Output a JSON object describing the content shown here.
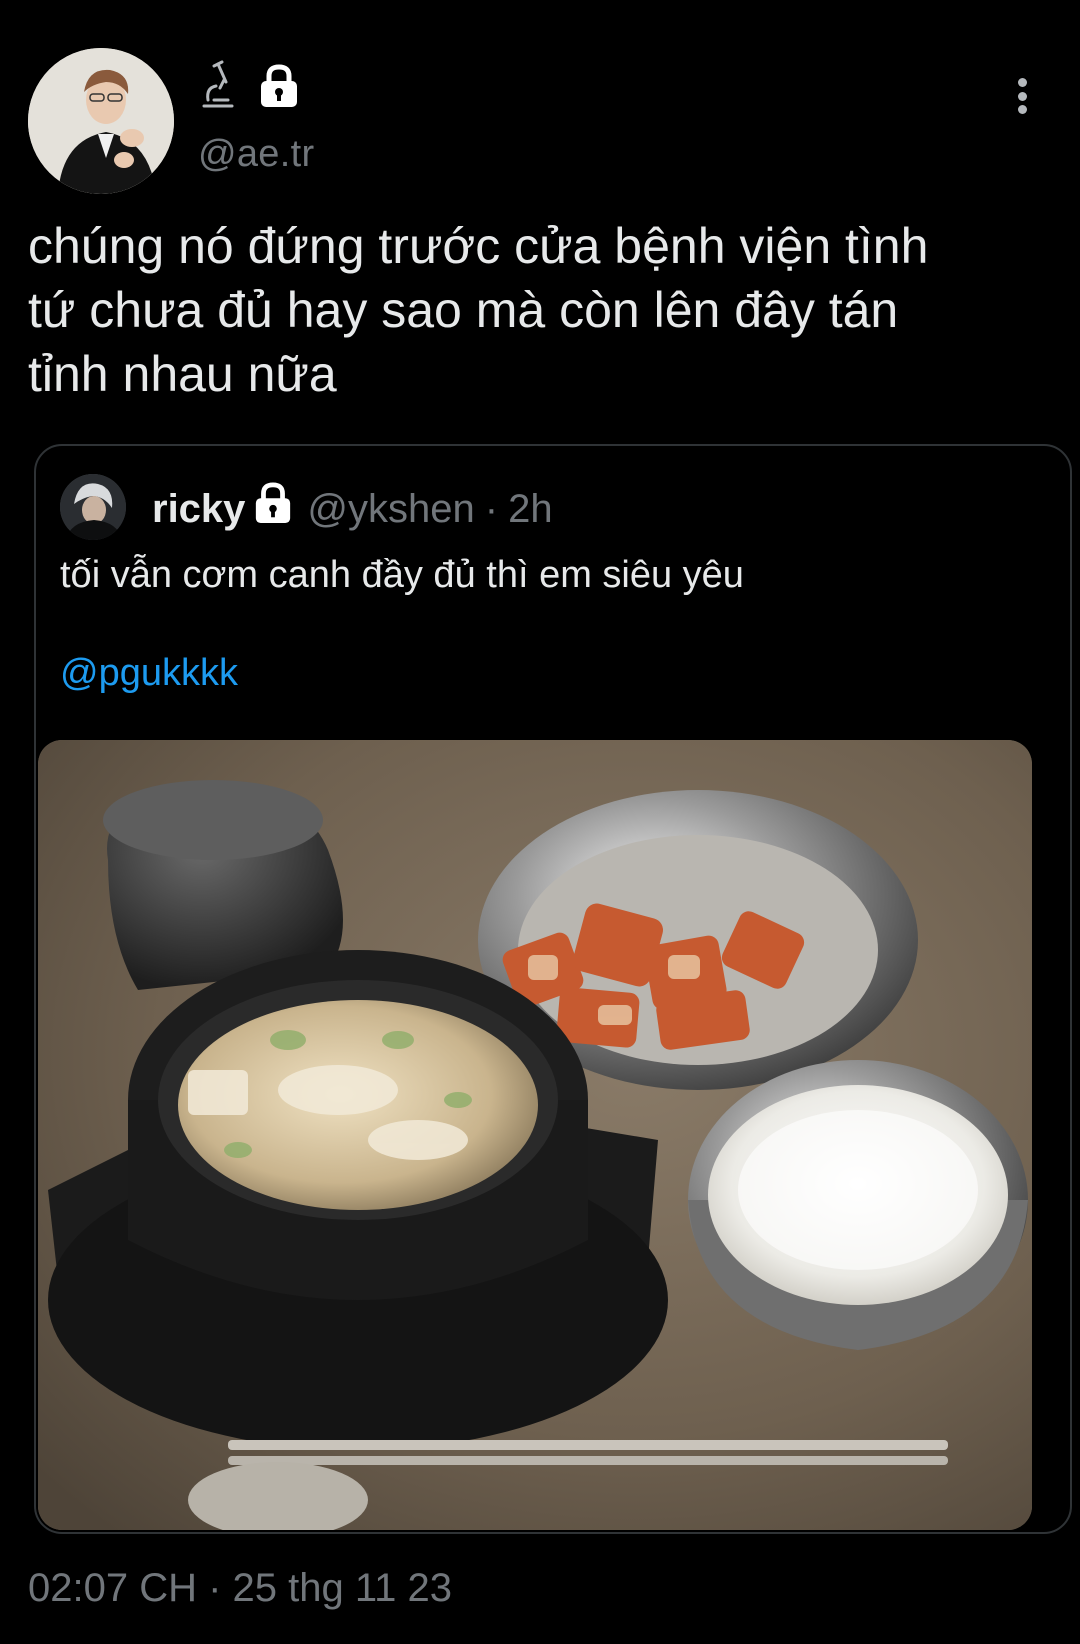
{
  "tweet": {
    "author_handle": "@ae.tr",
    "author_badges": [
      "microscope-icon",
      "lock-icon"
    ],
    "text": "chúng nó đứng trước cửa bệnh viện tình\ntứ chưa đủ hay sao mà còn lên đây tán\ntỉnh nhau nữa",
    "timestamp": "02:07 CH · 25 thg 11 23"
  },
  "quote": {
    "name": "ricky",
    "handle": "@ykshen",
    "separator": "·",
    "time": "2h",
    "text": "tối vẫn cơm canh đầy đủ thì em siêu yêu",
    "mention": "@pgukkkk",
    "media_description_icon": "photo"
  },
  "colors": {
    "background": "#000000",
    "text": "#e7e9ea",
    "muted": "#71767b",
    "link": "#1d9bf0",
    "border": "#2f3336"
  }
}
